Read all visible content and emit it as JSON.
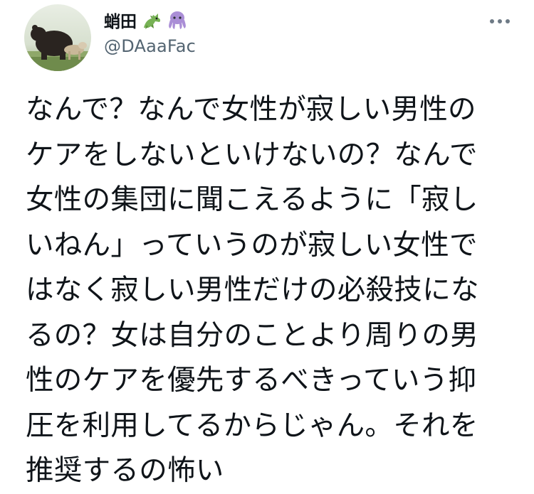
{
  "tweet": {
    "display_name": "蛸田",
    "emojis": [
      "dragon-emoji",
      "octopus-emoji"
    ],
    "handle": "@DAaaFac",
    "more_icon": "more-horizontal-icon",
    "lines": [
      "なんで？なんで女性が寂しい男性の",
      "ケアをしないといけないの？なんで",
      "女性の集団に聞こえるように「寂し",
      "いねん」っていうのが寂しい女性で",
      "はなく寂しい男性だけの必殺技にな",
      "るの？女は自分のことより周りの男",
      "性のケアを優先するべきっていう抑",
      "圧を利用してるからじゃん。それを",
      "推奨するの怖い"
    ]
  },
  "colors": {
    "text": "#0f1419",
    "secondary": "#536471",
    "dragon": "#77b255",
    "octopus": "#aa8ed6"
  }
}
